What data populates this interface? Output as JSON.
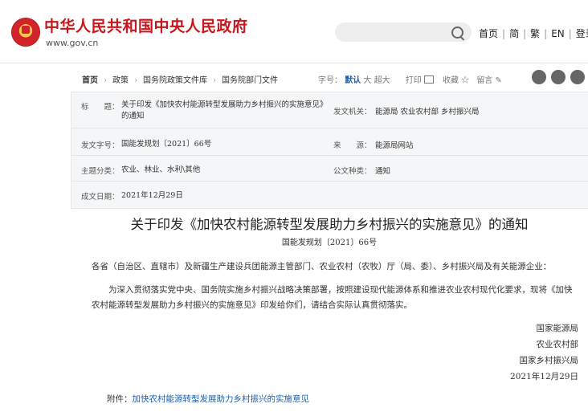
{
  "site": {
    "title": "中华人民共和国中央人民政府",
    "url": "www.gov.cn"
  },
  "nav": {
    "links": [
      "首页",
      "简",
      "繁",
      "EN",
      "登录"
    ]
  },
  "breadcrumb": [
    "首页",
    "政策",
    "国务院政策文件库",
    "国务院部门文件"
  ],
  "tools": {
    "font_label": "字号：",
    "font_default": "默认",
    "font_large": "大",
    "font_xlarge": "超大",
    "print": "打印",
    "favorite": "收藏",
    "comment": "留言"
  },
  "meta": {
    "title_key": "标　　题：",
    "title_val": "关于印发《加快农村能源转型发展助力乡村振兴的实施意见》的通知",
    "issuer_key": "发文机关：",
    "issuer_val": "能源局  农业农村部  乡村振兴局",
    "docno_key": "发文字号：",
    "docno_val": "国能发规划〔2021〕66号",
    "source_key": "来　　源：",
    "source_val": "能源局网站",
    "topic_key": "主题分类：",
    "topic_val": "农业、林业、水利\\其他",
    "type_key": "公文种类：",
    "type_val": "通知",
    "date_key": "成文日期：",
    "date_val": "2021年12月29日"
  },
  "doc": {
    "title": "关于印发《加快农村能源转型发展助力乡村振兴的实施意见》的通知",
    "number": "国能发规划〔2021〕66号",
    "salutation": "各省（自治区、直辖市）及新疆生产建设兵团能源主管部门、农业农村（农牧）厅（局、委）、乡村振兴局及有关能源企业：",
    "paragraph": "为深入贯彻落实党中央、国务院实施乡村振兴战略决策部署，按照建设现代能源体系和推进农业农村现代化要求，现将《加快农村能源转型发展助力乡村振兴的实施意见》印发给你们，请结合实际认真贯彻落实。",
    "signers": [
      "国家能源局",
      "农业农村部",
      "国家乡村振兴局"
    ],
    "sign_date": "2021年12月29日",
    "attachment_label": "附件：",
    "attachment_link": "加快农村能源转型发展助力乡村振兴的实施意见"
  },
  "colors": {
    "brand_red": "#c8161d",
    "link_blue": "#1f5fa8"
  }
}
